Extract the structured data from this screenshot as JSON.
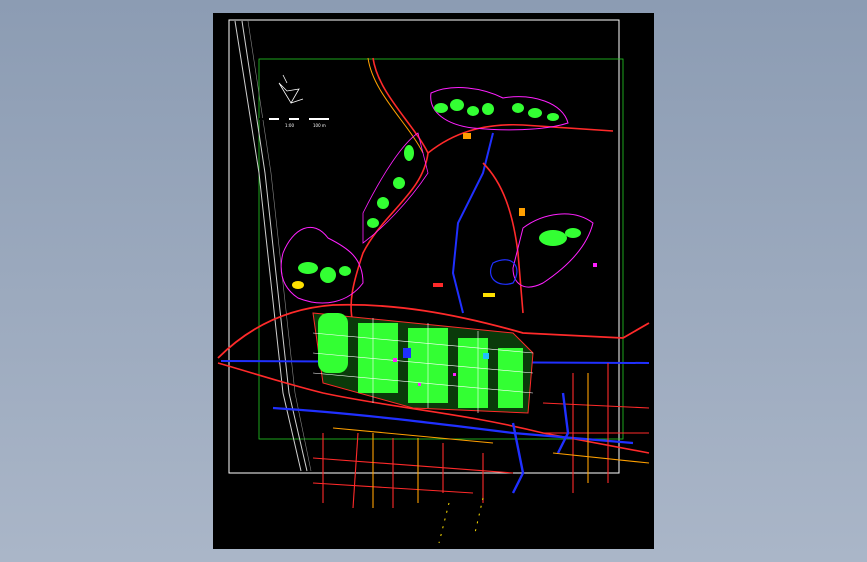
{
  "viewer": {
    "background": "#8c9cb3",
    "canvas_background": "#000000",
    "colors": {
      "frame": "#ffffff",
      "plan_boundary": "#22cc22",
      "road_red": "#ff2a2a",
      "road_orange": "#ffa000",
      "road_yellow": "#ffe000",
      "water_blue": "#2030ff",
      "magenta": "#ff20ff",
      "green_fill": "#33ff33",
      "rail": "#cfcfcf"
    }
  },
  "drawing": {
    "north_arrow_icon": "north-arrow-icon",
    "scale_bar": {
      "label_left": "1:00",
      "label_right": "100 m"
    }
  }
}
